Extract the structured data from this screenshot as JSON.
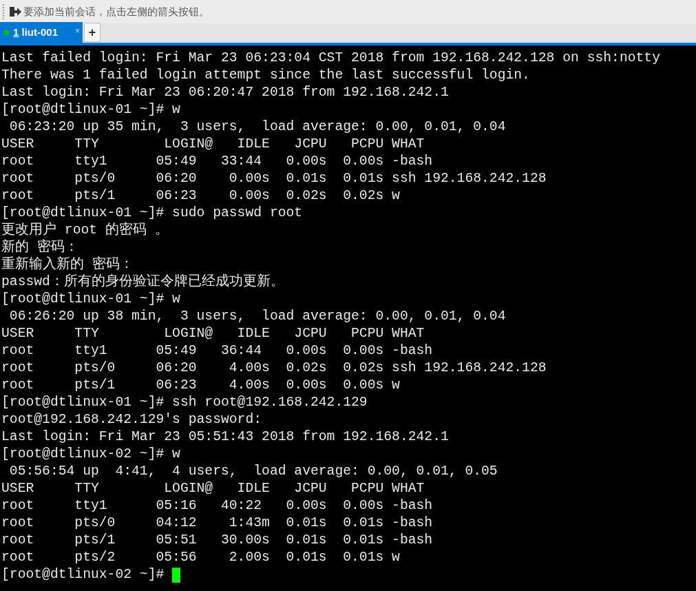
{
  "toolbar": {
    "hint": "要添加当前会话，点击左侧的箭头按钮。"
  },
  "tabs": [
    {
      "number": "1",
      "label": "liut-001",
      "selected": true,
      "connected": true,
      "close": "×"
    }
  ],
  "new_tab": "+",
  "terminal": {
    "cursor": true,
    "lines": [
      "Last failed login: Fri Mar 23 06:23:04 CST 2018 from 192.168.242.128 on ssh:notty",
      "There was 1 failed login attempt since the last successful login.",
      "Last login: Fri Mar 23 06:20:47 2018 from 192.168.242.1",
      "[root@dtlinux-01 ~]# w",
      " 06:23:20 up 35 min,  3 users,  load average: 0.00, 0.01, 0.04",
      "USER     TTY        LOGIN@   IDLE   JCPU   PCPU WHAT",
      "root     tty1      05:49   33:44   0.00s  0.00s -bash",
      "root     pts/0     06:20    0.00s  0.01s  0.01s ssh 192.168.242.128",
      "root     pts/1     06:23    0.00s  0.02s  0.02s w",
      "[root@dtlinux-01 ~]# sudo passwd root",
      "更改用户 root 的密码 。",
      "新的 密码：",
      "重新输入新的 密码：",
      "passwd：所有的身份验证令牌已经成功更新。",
      "[root@dtlinux-01 ~]# w",
      " 06:26:20 up 38 min,  3 users,  load average: 0.00, 0.01, 0.04",
      "USER     TTY        LOGIN@   IDLE   JCPU   PCPU WHAT",
      "root     tty1      05:49   36:44   0.00s  0.00s -bash",
      "root     pts/0     06:20    4.00s  0.02s  0.02s ssh 192.168.242.128",
      "root     pts/1     06:23    4.00s  0.00s  0.00s w",
      "[root@dtlinux-01 ~]# ssh root@192.168.242.129",
      "root@192.168.242.129's password:",
      "Last login: Fri Mar 23 05:51:43 2018 from 192.168.242.1",
      "[root@dtlinux-02 ~]# w",
      " 05:56:54 up  4:41,  4 users,  load average: 0.00, 0.01, 0.05",
      "USER     TTY        LOGIN@   IDLE   JCPU   PCPU WHAT",
      "root     tty1      05:16   40:22   0.00s  0.00s -bash",
      "root     pts/0     04:12    1:43m  0.01s  0.01s -bash",
      "root     pts/1     05:51   30.00s  0.01s  0.01s -bash",
      "root     pts/2     05:56    2.00s  0.01s  0.01s w",
      "[root@dtlinux-02 ~]# "
    ]
  }
}
